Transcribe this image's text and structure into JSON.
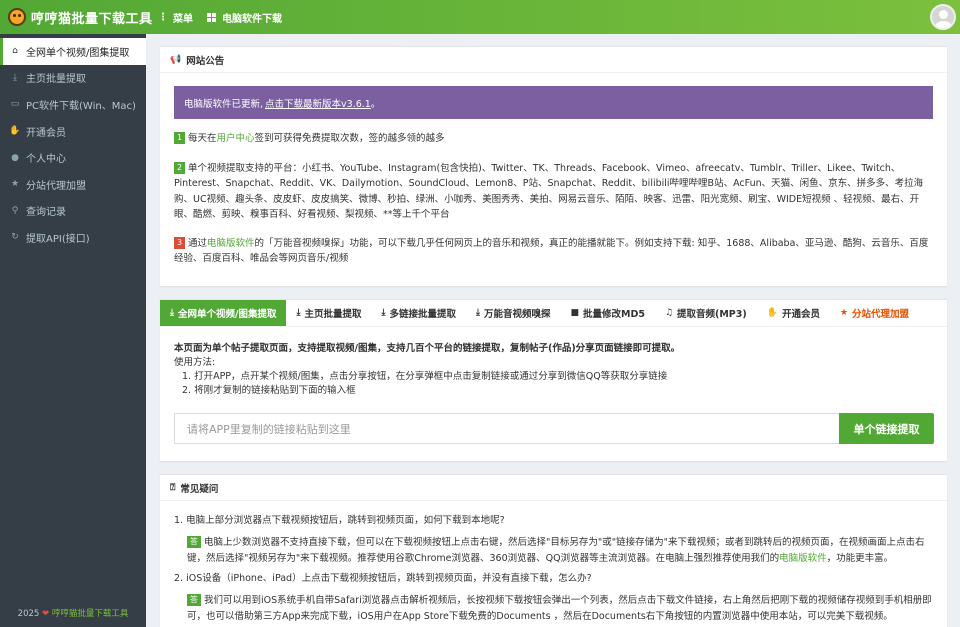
{
  "app": {
    "title": "哼哼猫批量下载工具",
    "menu_label": "菜单",
    "pc_download_label": "电脑软件下载"
  },
  "sidebar": {
    "items": [
      {
        "label": "全网单个视频/图集提取",
        "icon": "home-icon",
        "active": true
      },
      {
        "label": "主页批量提取",
        "icon": "download-icon"
      },
      {
        "label": "PC软件下载(Win、Mac)",
        "icon": "desktop-icon"
      },
      {
        "label": "开通会员",
        "icon": "thumbs-up-icon"
      },
      {
        "label": "个人中心",
        "icon": "user-icon"
      },
      {
        "label": "分站代理加盟",
        "icon": "star-icon"
      },
      {
        "label": "查询记录",
        "icon": "search-icon"
      },
      {
        "label": "提取API(接口)",
        "icon": "refresh-icon"
      }
    ],
    "footer_year": "2025",
    "footer_brand": "哼哼猫批量下载工具"
  },
  "notice": {
    "title": "网站公告",
    "banner_prefix": "电脑版软件已更新,",
    "banner_link": "点击下载最新版本v3.6.1",
    "banner_suffix": "。",
    "item1": {
      "num": "1",
      "pre": "每天在",
      "link": "用户中心",
      "post": "签到可获得免费提取次数，签的越多领的越多"
    },
    "item2": {
      "num": "2",
      "text": "单个视频提取支持的平台：小红书、YouTube、Instagram(包含快拍)、Twitter、TK、Threads、Facebook、Vimeo、afreecatv、Tumblr、Triller、Likee、Twitch、Pinterest、Snapchat、Reddit、VK、Dailymotion、SoundCloud、Lemon8、P站、Snapchat、Reddit、bilibili哔哩哔哩B站、AcFun、天猫、闲鱼、京东、拼多多、考拉海购、UC视频、趣头条、皮皮虾、皮皮搞笑、微博、秒拍、绿洲、小咖秀、美图秀秀、美拍、网易云音乐、陌陌、映客、迅雷、阳光宽频、刷宝、WIDE短视频 、轻视频、最右、开眼、酷燃、剪映、糗事百科、好看视频、梨视频、**等上千个平台"
    },
    "item3": {
      "num": "3",
      "pre": "通过",
      "link": "电脑版软件",
      "post": "的「万能音视频嗅探」功能，可以下载几乎任何网页上的音乐和视频，真正的能播就能下。例如支持下载: 知乎、1688、Alibaba、亚马逊、酷狗、云音乐、百度经验、百度百科、唯品会等网页音乐/视频"
    }
  },
  "tool": {
    "tabs": [
      {
        "label": "全网单个视频/图集提取",
        "icon": "download-icon",
        "active": true
      },
      {
        "label": "主页批量提取",
        "icon": "download-icon"
      },
      {
        "label": "多链接批量提取",
        "icon": "download-icon"
      },
      {
        "label": "万能音视频嗅探",
        "icon": "download-icon"
      },
      {
        "label": "批量修改MD5",
        "icon": "video-icon"
      },
      {
        "label": "提取音频(MP3)",
        "icon": "music-icon"
      },
      {
        "label": "开通会员",
        "icon": "thumbs-up-icon"
      },
      {
        "label": "分站代理加盟",
        "icon": "star-icon",
        "hot": true
      }
    ],
    "desc_bold": "本页面为单个帖子提取页面，支持提取视频/图集，支持几百个平台的链接提取，复制帖子(作品)分享页面链接即可提取。",
    "usage_title": "使用方法:",
    "step1": "1. 打开APP，点开某个视频/图集，点击分享按钮，在分享弹框中点击复制链接或通过分享到微信QQ等获取分享链接",
    "step2": "2. 将刚才复制的链接粘贴到下面的输入框",
    "input_placeholder": "请将APP里复制的链接粘贴到这里",
    "button_label": "单个链接提取"
  },
  "faq": {
    "title": "常见疑问",
    "answer_badge": "答",
    "q1": "1. 电脑上部分浏览器点下载视频按钮后，跳转到视频页面，如何下载到本地呢?",
    "a1_pre": "电脑上少数浏览器不支持直接下载，但可以在下载视频按钮上点击右键，然后选择\"目标另存为\"或\"链接存储为\"来下载视频；或者到跳转后的视频页面，在视频画面上点击右键，然后选择\"视频另存为\"来下载视频。推荐使用谷歌Chrome浏览器、360浏览器、QQ浏览器等主流浏览器。在电脑上强烈推荐使用我们的",
    "a1_link": "电脑版软件",
    "a1_post": "，功能更丰富。",
    "q2": "2. iOS设备（iPhone、iPad）上点击下载视频按钮后，跳转到视频页面，并没有直接下载，怎么办?",
    "a2": "我们可以用到iOS系统手机自带Safari浏览器点击解析视频后，长按视频下载按钮会弹出一个列表，然后点击下载文件链接，右上角然后把刚下载的视频储存视频到手机相册即可，也可以借助第三方App来完成下载，iOS用户在App Store下载免费的Documents ，然后在Documents右下角按钮的内置浏览器中使用本站，可以完美下载视频。"
  }
}
